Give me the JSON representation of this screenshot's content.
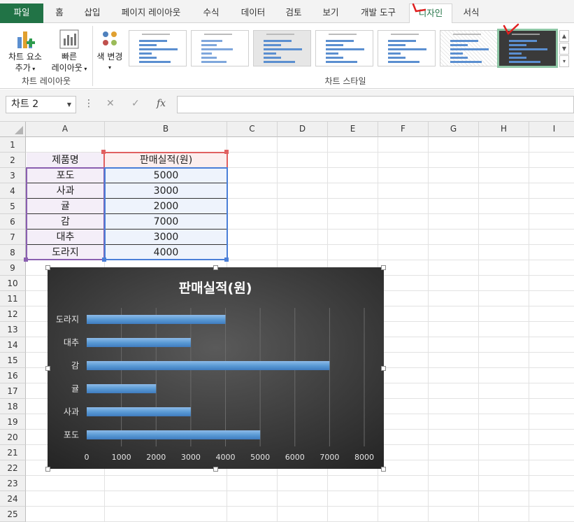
{
  "ribbon_tabs": [
    "파일",
    "홈",
    "삽입",
    "페이지 레이아웃",
    "수식",
    "데이터",
    "검토",
    "보기",
    "개발 도구",
    "디자인",
    "서식"
  ],
  "ribbon": {
    "add_element_line1": "차트 요소",
    "add_element_line2": "추가",
    "quick_layout_line1": "빠른",
    "quick_layout_line2": "레이아웃",
    "change_color": "색 변경",
    "group_chart_layout": "차트 레이아웃",
    "group_chart_styles": "차트 스타일"
  },
  "formula_bar": {
    "name_box": "차트 2",
    "formula": ""
  },
  "columns": [
    "A",
    "B",
    "C",
    "D",
    "E",
    "F",
    "G",
    "H",
    "I"
  ],
  "rows": [
    "1",
    "2",
    "3",
    "4",
    "5",
    "6",
    "7",
    "8",
    "9",
    "10",
    "11",
    "12",
    "13",
    "14",
    "15",
    "16",
    "17",
    "18",
    "19",
    "20",
    "21",
    "22",
    "23",
    "24",
    "25"
  ],
  "table": {
    "header_a": "제품명",
    "header_b": "판매실적(원)",
    "rows": [
      {
        "name": "포도",
        "value": "5000"
      },
      {
        "name": "사과",
        "value": "3000"
      },
      {
        "name": "귤",
        "value": "2000"
      },
      {
        "name": "감",
        "value": "7000"
      },
      {
        "name": "대추",
        "value": "3000"
      },
      {
        "name": "도라지",
        "value": "4000"
      }
    ]
  },
  "chart_data": {
    "type": "bar",
    "orientation": "horizontal",
    "title": "판매실적(원)",
    "categories": [
      "포도",
      "사과",
      "귤",
      "감",
      "대추",
      "도라지"
    ],
    "values": [
      5000,
      3000,
      2000,
      7000,
      3000,
      4000
    ],
    "xlim": [
      0,
      8000
    ],
    "ticks": [
      "0",
      "1000",
      "2000",
      "3000",
      "4000",
      "5000",
      "6000",
      "7000",
      "8000"
    ],
    "grid": true,
    "colors": {
      "background": "#3a3a3a",
      "bar": "#5b9bd5",
      "text": "#ffffff"
    }
  }
}
